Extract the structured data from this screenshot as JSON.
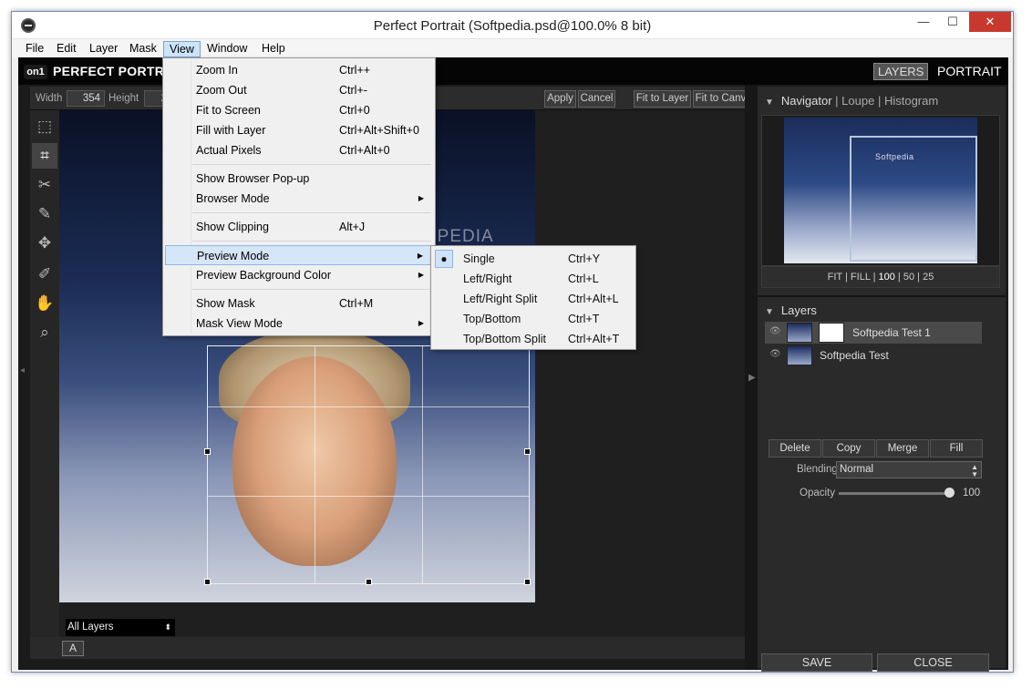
{
  "window": {
    "title": "Perfect Portrait (Softpedia.psd@100.0% 8 bit)",
    "min": "—",
    "max": "☐",
    "close": "✕"
  },
  "menubar": [
    "File",
    "Edit",
    "Layer",
    "Mask",
    "View",
    "Window",
    "Help"
  ],
  "brand": {
    "logo": "on1",
    "name": "PERFECT PORTR",
    "mode_layers": "LAYERS",
    "mode_portrait": "PORTRAIT"
  },
  "options": {
    "width_label": "Width",
    "width_value": "354",
    "height_label": "Height",
    "height_value": "2",
    "apply": "Apply",
    "cancel": "Cancel",
    "fit_layer": "Fit to Layer",
    "fit_canvas": "Fit to Canvas"
  },
  "canvas": {
    "watermark": "SOFTPEDIA",
    "layers_select": "All Layers",
    "a_button": "A"
  },
  "view_menu": [
    {
      "label": "Zoom In",
      "shortcut": "Ctrl++"
    },
    {
      "label": "Zoom Out",
      "shortcut": "Ctrl+-"
    },
    {
      "label": "Fit to Screen",
      "shortcut": "Ctrl+0"
    },
    {
      "label": "Fill with Layer",
      "shortcut": "Ctrl+Alt+Shift+0"
    },
    {
      "label": "Actual Pixels",
      "shortcut": "Ctrl+Alt+0"
    },
    {
      "label": "Show Browser Pop-up",
      "shortcut": ""
    },
    {
      "label": "Browser Mode",
      "shortcut": ""
    },
    {
      "label": "Show Clipping",
      "shortcut": "Alt+J"
    },
    {
      "label": "Preview Mode",
      "shortcut": ""
    },
    {
      "label": "Preview Background Color",
      "shortcut": ""
    },
    {
      "label": "Show Mask",
      "shortcut": "Ctrl+M"
    },
    {
      "label": "Mask View Mode",
      "shortcut": ""
    }
  ],
  "preview_submenu": [
    {
      "label": "Single",
      "shortcut": "Ctrl+Y"
    },
    {
      "label": "Left/Right",
      "shortcut": "Ctrl+L"
    },
    {
      "label": "Left/Right Split",
      "shortcut": "Ctrl+Alt+L"
    },
    {
      "label": "Top/Bottom",
      "shortcut": "Ctrl+T"
    },
    {
      "label": "Top/Bottom Split",
      "shortcut": "Ctrl+Alt+T"
    }
  ],
  "navigator": {
    "tab_navigator": "Navigator",
    "tab_loupe": "Loupe",
    "tab_histogram": "Histogram",
    "nav_title": "Softpedia",
    "zoom_fit": "FIT",
    "zoom_fill": "FILL",
    "zoom_100": "100",
    "zoom_50": "50",
    "zoom_25": "25"
  },
  "layers": {
    "header": "Layers",
    "items": [
      {
        "name": "Softpedia Test 1"
      },
      {
        "name": "Softpedia Test"
      }
    ],
    "delete": "Delete",
    "copy": "Copy",
    "merge": "Merge",
    "fill": "Fill",
    "blending_label": "Blending",
    "blending_value": "Normal",
    "opacity_label": "Opacity",
    "opacity_value": "100"
  },
  "footer": {
    "save": "SAVE",
    "close": "CLOSE"
  },
  "colors": {
    "menu_highlight": "#d5e6f8",
    "close_red": "#c7392e",
    "panel_bg": "#2a2a2a"
  }
}
